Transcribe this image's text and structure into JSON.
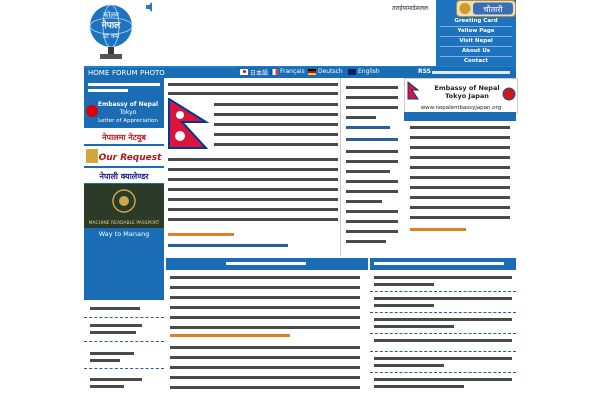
{
  "header": {
    "site_title_line1": "कोलव",
    "site_title_line2": "नेपाल",
    "site_title_line3": "डट कम",
    "chautari_label": "चौतारी",
    "status_text": "तराईयामाडेसलल"
  },
  "right_nav": [
    {
      "label": "Greeting Card"
    },
    {
      "label": "Yellow Page"
    },
    {
      "label": "Visit Nepal"
    },
    {
      "label": "About Us"
    },
    {
      "label": "Contact"
    }
  ],
  "menu": [
    {
      "label": "HOME"
    },
    {
      "label": "FORUM"
    },
    {
      "label": "PHOTO"
    }
  ],
  "languages": [
    {
      "label": "日本語"
    },
    {
      "label": "Français"
    },
    {
      "label": "Deutsch"
    },
    {
      "label": "English"
    }
  ],
  "rss_label": "RSS",
  "left_banners": {
    "embassy_title": "Embassy of Nepal",
    "embassy_city": "Tokyo",
    "embassy_sub": "Letter of Appreciation",
    "nepali_news": "नेपालमा नेटयुब",
    "our_request": "Our Request",
    "nepali_calendar": "नेपाली क्यालेण्डर",
    "passport_caption": "MACHINE READABLE PASSPORT",
    "way_to_manang": "Way to Manang"
  },
  "right_banner": {
    "title1": "Embassy of Nepal",
    "title2": "Tokyo Japan",
    "url": "www.nepalembassyjapan.org"
  },
  "colors": {
    "primary_blue": "#1a6db5",
    "light_blue": "#1e7fc8",
    "nav_border": "#7fb0e0",
    "nepal_red": "#dc143c",
    "nepal_blue": "#003893",
    "link_orange": "#d9822b"
  }
}
